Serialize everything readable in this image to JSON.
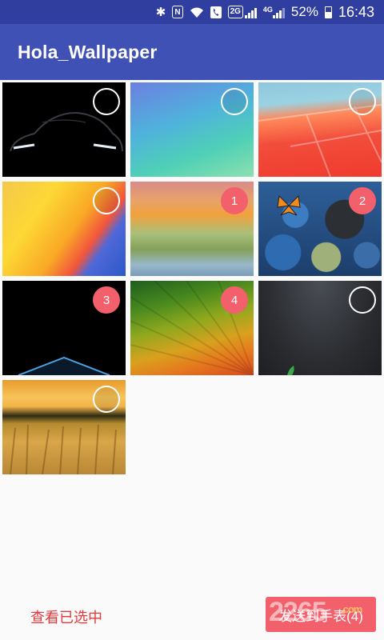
{
  "status_bar": {
    "icons": [
      "bluetooth-icon",
      "nfc-icon",
      "wifi-icon",
      "call-icon",
      "signal-2g-icon",
      "signal-4g-icon",
      "battery-icon"
    ],
    "tag_2g": "2G",
    "tag_4g": "4G",
    "nfc_label": "N",
    "battery": "52%",
    "time": "16:43"
  },
  "app_bar": {
    "title": "Hola_Wallpaper"
  },
  "wallpapers": [
    {
      "name": "wallpaper-car",
      "selected": false,
      "badge": ""
    },
    {
      "name": "wallpaper-blue-green-feathers",
      "selected": false,
      "badge": ""
    },
    {
      "name": "wallpaper-colorful-tiles",
      "selected": false,
      "badge": ""
    },
    {
      "name": "wallpaper-material-curves",
      "selected": false,
      "badge": ""
    },
    {
      "name": "wallpaper-paper-stripes",
      "selected": true,
      "badge": "1"
    },
    {
      "name": "wallpaper-pebbles-butterfly",
      "selected": true,
      "badge": "2"
    },
    {
      "name": "wallpaper-dark-pyramid",
      "selected": true,
      "badge": "3"
    },
    {
      "name": "wallpaper-green-orange-rays",
      "selected": true,
      "badge": "4"
    },
    {
      "name": "wallpaper-asphalt",
      "selected": false,
      "badge": ""
    },
    {
      "name": "wallpaper-wheat-field",
      "selected": false,
      "badge": ""
    }
  ],
  "bottom_bar": {
    "view_selected_label": "查看已选中",
    "send_button_label": "发送到手表(4)"
  },
  "watermark": {
    "text": "2265",
    "sub": ".com"
  },
  "colors": {
    "primary": "#3f51b5",
    "primary_dark": "#303f9f",
    "accent": "#f2606c",
    "accent_text": "#e5393c"
  }
}
